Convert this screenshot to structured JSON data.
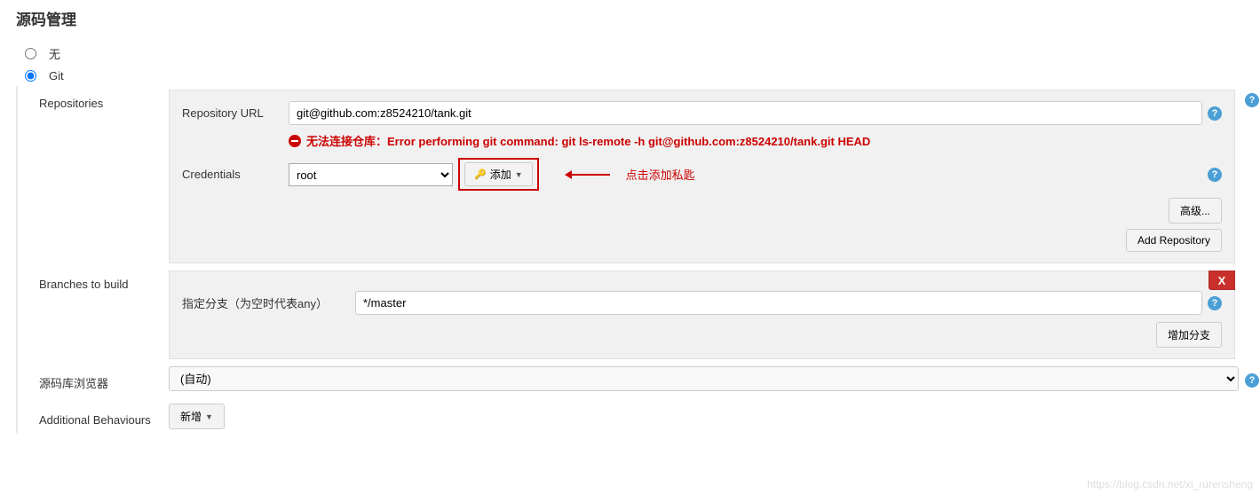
{
  "section_title": "源码管理",
  "scm": {
    "none_label": "无",
    "git_label": "Git"
  },
  "repositories": {
    "label": "Repositories",
    "repo_url_label": "Repository URL",
    "repo_url_value": "git@github.com:z8524210/tank.git",
    "error_message": "无法连接仓库：Error performing git command: git ls-remote -h git@github.com:z8524210/tank.git HEAD",
    "credentials_label": "Credentials",
    "credentials_value": "root",
    "add_button": "添加",
    "annotation": "点击添加私匙",
    "advanced_button": "高级...",
    "add_repo_button": "Add Repository"
  },
  "branches": {
    "label": "Branches to build",
    "branch_specifier_label": "指定分支（为空时代表any）",
    "branch_value": "*/master",
    "add_branch_button": "增加分支"
  },
  "browser": {
    "label": "源码库浏览器",
    "value": "(自动)"
  },
  "behaviours": {
    "label": "Additional Behaviours",
    "add_button": "新增"
  },
  "watermark": "https://blog.csdn.net/xi_rurensheng"
}
